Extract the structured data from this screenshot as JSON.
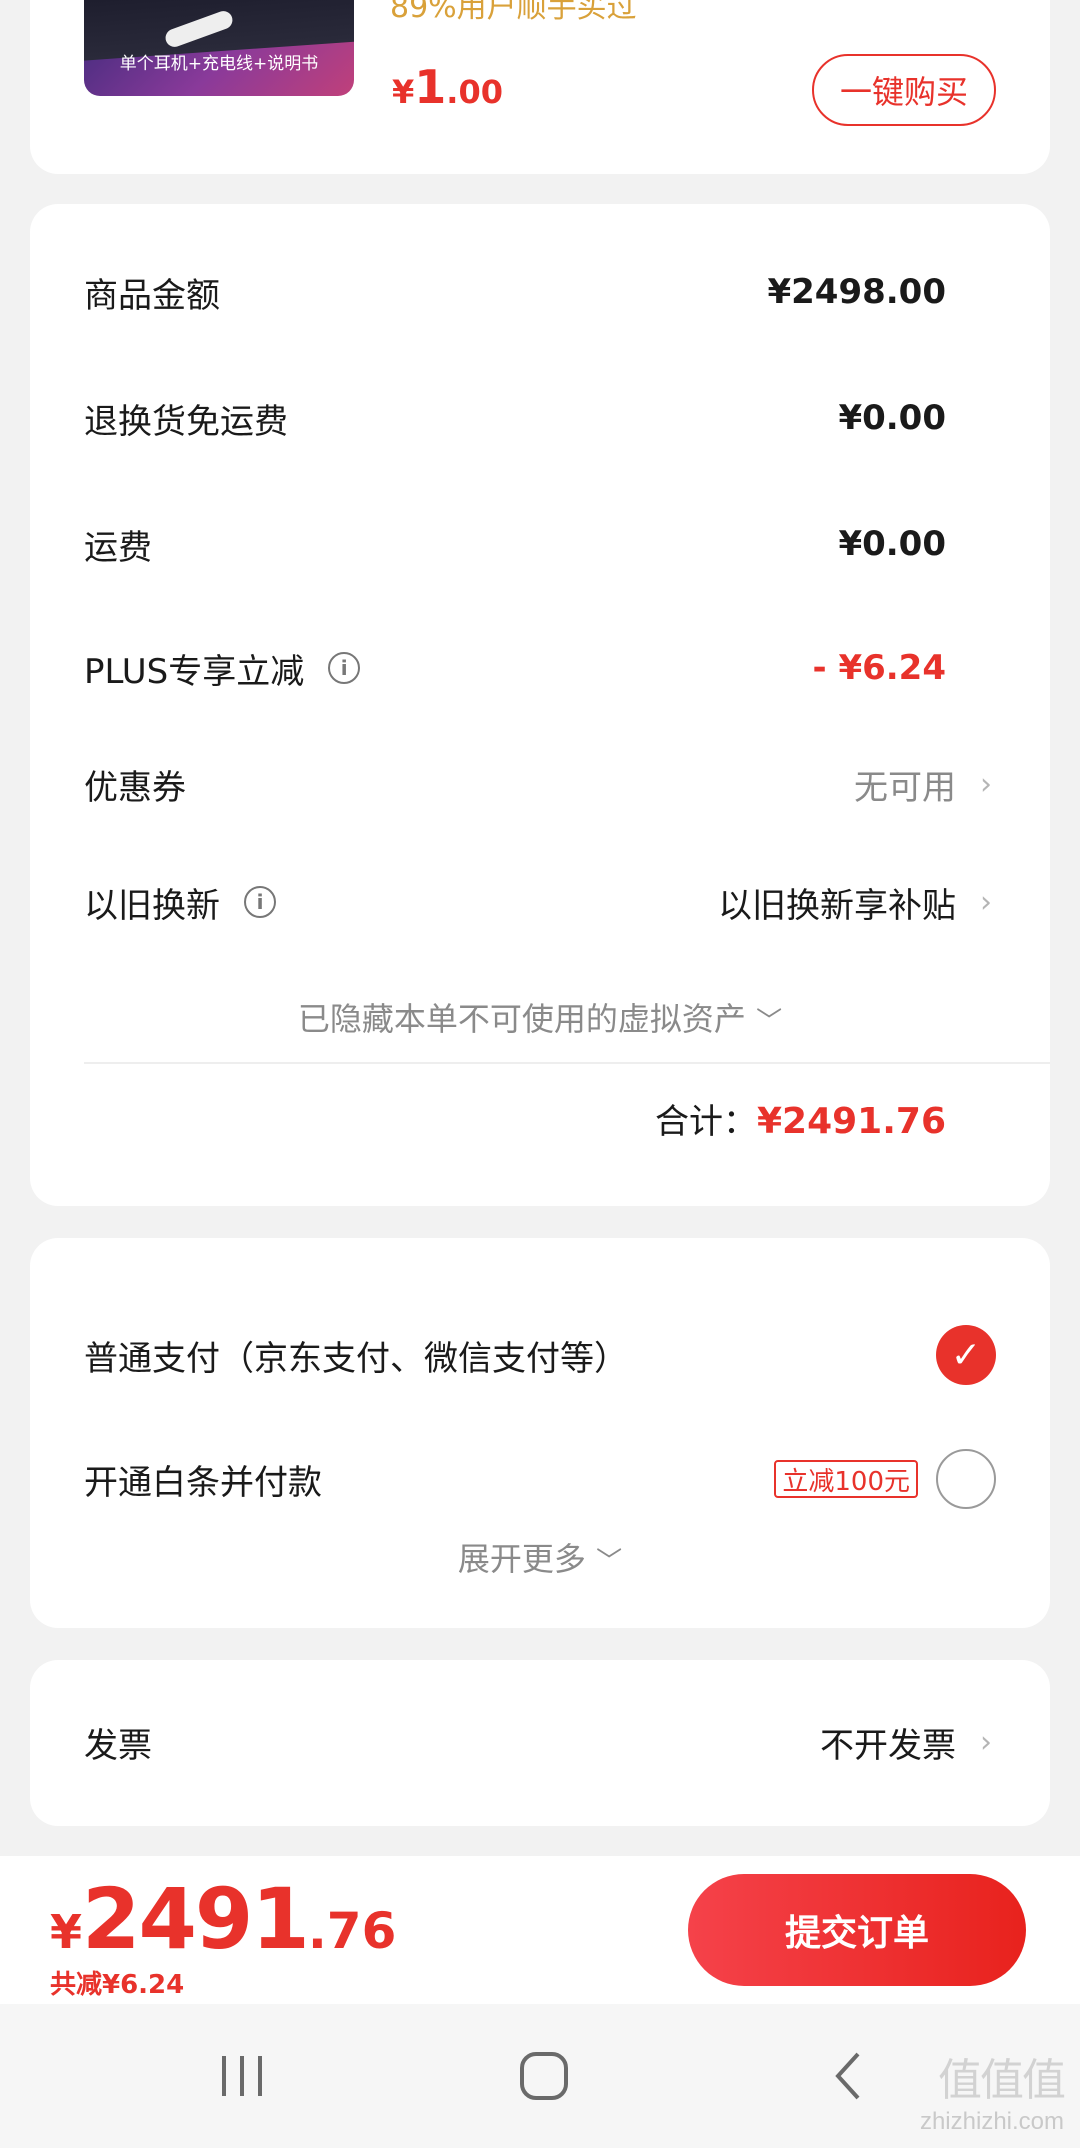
{
  "product": {
    "thumb_caption": "单个耳机+充电线+说明书",
    "bought_text": "89%用户顺手买过",
    "price_symbol": "¥",
    "price_int": "1",
    "price_dec": ".00",
    "buy_button": "一键购买"
  },
  "summary": {
    "rows": [
      {
        "label": "商品金额",
        "value": "¥2498.00"
      },
      {
        "label": "退换货免运费",
        "value": "¥0.00"
      },
      {
        "label": "运费",
        "value": "¥0.00"
      },
      {
        "label": "PLUS专享立减",
        "value": "- ¥6.24"
      },
      {
        "label": "优惠券",
        "value": "无可用"
      },
      {
        "label": "以旧换新",
        "value": "以旧换新享补贴"
      }
    ],
    "hidden_note": "已隐藏本单不可使用的虚拟资产",
    "total_label": "合计：",
    "total_value": "¥2491.76"
  },
  "payment": {
    "options": [
      {
        "label": "普通支付（京东支付、微信支付等）",
        "selected": true
      },
      {
        "label": "开通白条并付款",
        "promo": "立减100元",
        "selected": false
      }
    ],
    "expand_label": "展开更多"
  },
  "invoice": {
    "label": "发票",
    "value": "不开发票"
  },
  "bottom": {
    "price_symbol": "¥",
    "price_int": "2491",
    "price_dec": ".76",
    "saved_text": "共减¥6.24",
    "submit_button": "提交订单"
  },
  "watermark": {
    "logo": "值值值",
    "domain": "zhizhizhi.com"
  },
  "colors": {
    "accent": "#e8322b",
    "price_gold": "#d9a13a",
    "muted": "#8a8a8a"
  }
}
